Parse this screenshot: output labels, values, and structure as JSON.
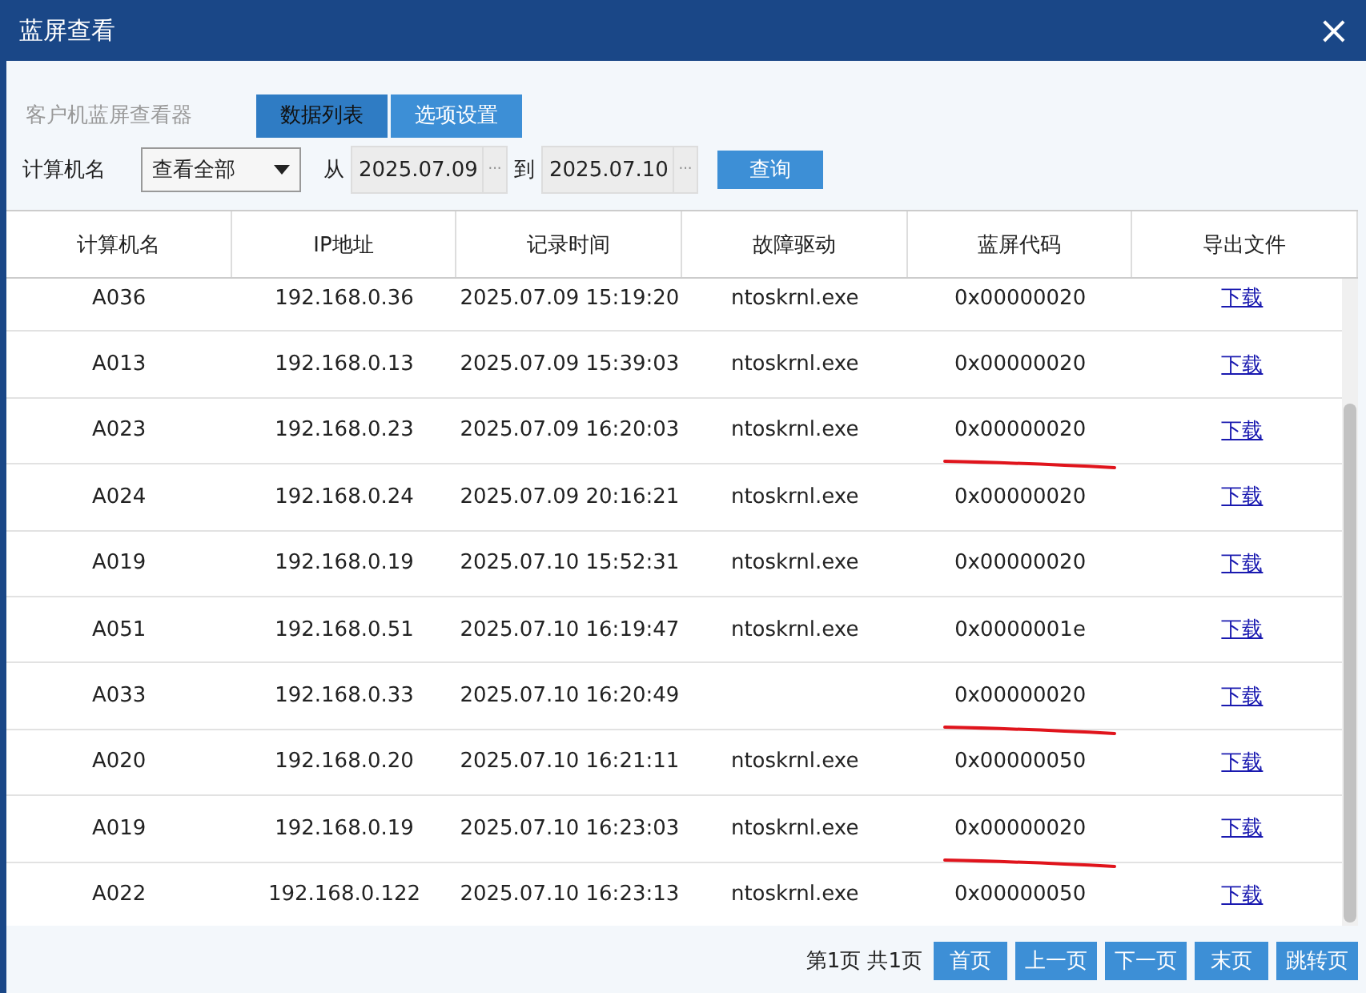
{
  "window": {
    "title": "蓝屏查看",
    "close": "×"
  },
  "app_label": "客户机蓝屏查看器",
  "tabs": [
    {
      "label": "数据列表",
      "selected": true
    },
    {
      "label": "选项设置",
      "selected": false
    }
  ],
  "filter": {
    "computer_label": "计算机名",
    "computer_value": "查看全部",
    "from_label": "从",
    "from_value": "2025.07.09",
    "to_label": "到",
    "to_value": "2025.07.10",
    "picker": "···",
    "query_button": "查询"
  },
  "table": {
    "columns": [
      "计算机名",
      "IP地址",
      "记录时间",
      "故障驱动",
      "蓝屏代码",
      "导出文件"
    ],
    "rows": [
      {
        "cells": [
          "A036",
          "192.168.0.36",
          "2025.07.09 15:19:20",
          "ntoskrnl.exe",
          "0x00000020",
          "下载"
        ],
        "marked": false
      },
      {
        "cells": [
          "A013",
          "192.168.0.13",
          "2025.07.09 15:39:03",
          "ntoskrnl.exe",
          "0x00000020",
          "下载"
        ],
        "marked": false
      },
      {
        "cells": [
          "A023",
          "192.168.0.23",
          "2025.07.09 16:20:03",
          "ntoskrnl.exe",
          "0x00000020",
          "下载"
        ],
        "marked": true
      },
      {
        "cells": [
          "A024",
          "192.168.0.24",
          "2025.07.09 20:16:21",
          "ntoskrnl.exe",
          "0x00000020",
          "下载"
        ],
        "marked": false
      },
      {
        "cells": [
          "A019",
          "192.168.0.19",
          "2025.07.10 15:52:31",
          "ntoskrnl.exe",
          "0x00000020",
          "下载"
        ],
        "marked": false
      },
      {
        "cells": [
          "A051",
          "192.168.0.51",
          "2025.07.10 16:19:47",
          "ntoskrnl.exe",
          "0x0000001e",
          "下载"
        ],
        "marked": false
      },
      {
        "cells": [
          "A033",
          "192.168.0.33",
          "2025.07.10 16:20:49",
          "",
          "0x00000020",
          "下载"
        ],
        "marked": true
      },
      {
        "cells": [
          "A020",
          "192.168.0.20",
          "2025.07.10 16:21:11",
          "ntoskrnl.exe",
          "0x00000050",
          "下载"
        ],
        "marked": false
      },
      {
        "cells": [
          "A019",
          "192.168.0.19",
          "2025.07.10 16:23:03",
          "ntoskrnl.exe",
          "0x00000020",
          "下载"
        ],
        "marked": true
      },
      {
        "cells": [
          "A022",
          "192.168.0.122",
          "2025.07.10 16:23:13",
          "ntoskrnl.exe",
          "0x00000050",
          "下载"
        ],
        "marked": false
      }
    ]
  },
  "pager": {
    "info": "第1页 共1页",
    "buttons": [
      "首页",
      "上一页",
      "下一页",
      "末页",
      "跳转页"
    ]
  }
}
